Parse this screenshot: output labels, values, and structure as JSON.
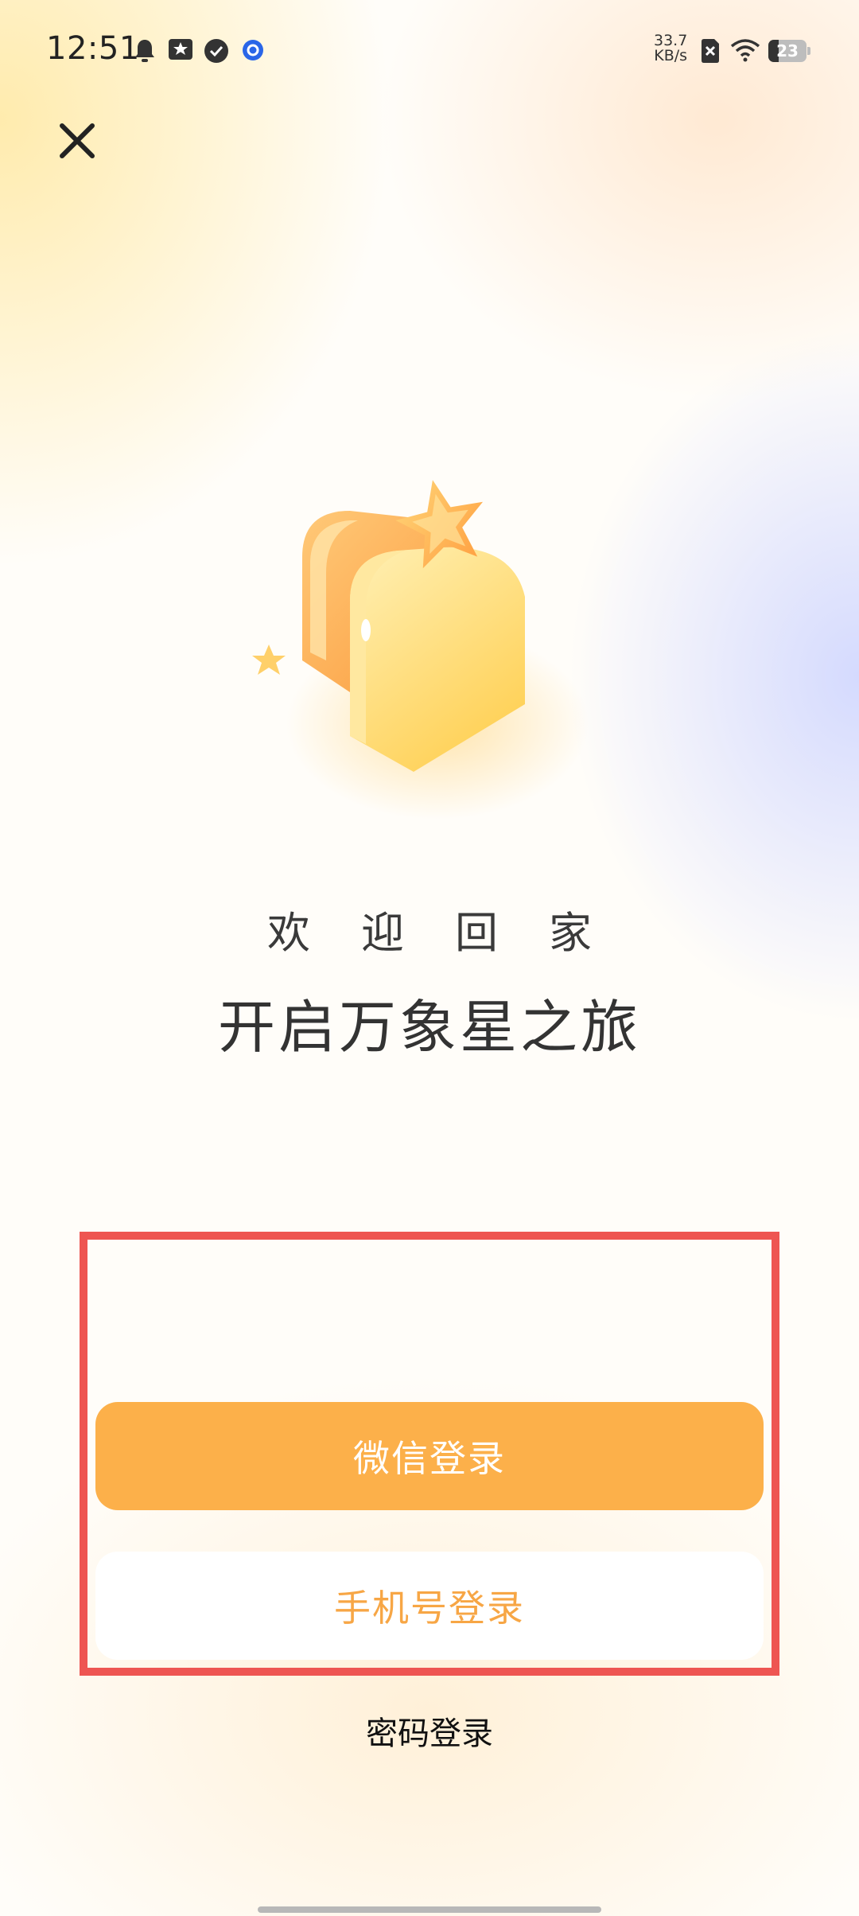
{
  "status_bar": {
    "time": "12:51",
    "net_speed_value": "33.7",
    "net_speed_unit": "KB/s",
    "battery": "23",
    "icons": [
      "notification-bell-icon",
      "star-badge-icon",
      "check-circle-icon",
      "app-circle-icon",
      "sim-off-icon",
      "wifi-icon",
      "battery-icon"
    ]
  },
  "header": {
    "close_icon": "close-icon"
  },
  "welcome": {
    "greeting": "欢迎回家",
    "slogan": "开启万象星之旅"
  },
  "login": {
    "wechat_label": "微信登录",
    "phone_label": "手机号登录",
    "password_label": "密码登录"
  },
  "colors": {
    "accent": "#fcb04a",
    "phone_text": "#f7a645",
    "highlight_frame": "#ee5552"
  }
}
